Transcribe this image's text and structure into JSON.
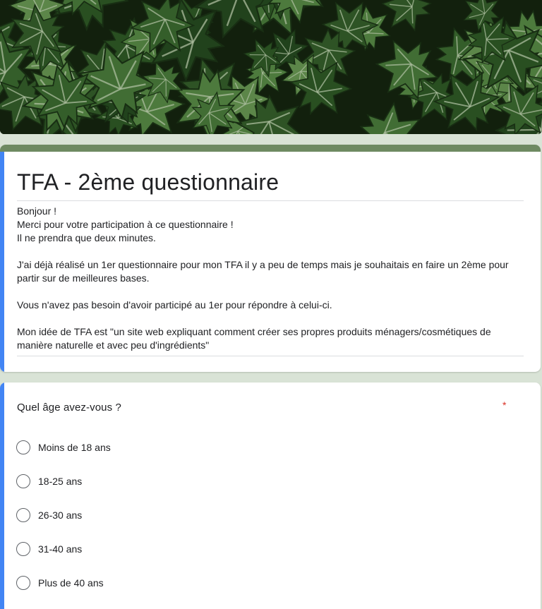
{
  "colors": {
    "page_background": "#d9e3d6",
    "theme_accent": "#6e8a62",
    "focus_accent": "#4285f4",
    "required": "#d93025"
  },
  "header_image": {
    "icon": "ivy-leaves-banner"
  },
  "form": {
    "title": "TFA - 2ème questionnaire",
    "description": {
      "lines": [
        "Bonjour !",
        "Merci pour votre participation à ce questionnaire !",
        "Il ne prendra que deux minutes.",
        "",
        "J'ai déjà réalisé un 1er questionnaire pour mon TFA il y a peu de temps mais je souhaitais en faire un 2ème pour",
        "partir sur de meilleures bases.",
        "",
        "Vous n'avez pas besoin d'avoir participé au 1er pour répondre à celui-ci.",
        "",
        "Mon idée de TFA est \"un site web expliquant comment créer ses propres produits ménagers/cosmétiques de",
        "manière naturelle et avec peu d'ingrédients\""
      ]
    }
  },
  "question": {
    "text": "Quel âge avez-vous ?",
    "required_mark": "*",
    "options": [
      {
        "label": "Moins de 18 ans",
        "selected": false
      },
      {
        "label": "18-25 ans",
        "selected": false
      },
      {
        "label": "26-30 ans",
        "selected": false
      },
      {
        "label": "31-40 ans",
        "selected": false
      },
      {
        "label": "Plus de 40 ans",
        "selected": false
      }
    ]
  }
}
